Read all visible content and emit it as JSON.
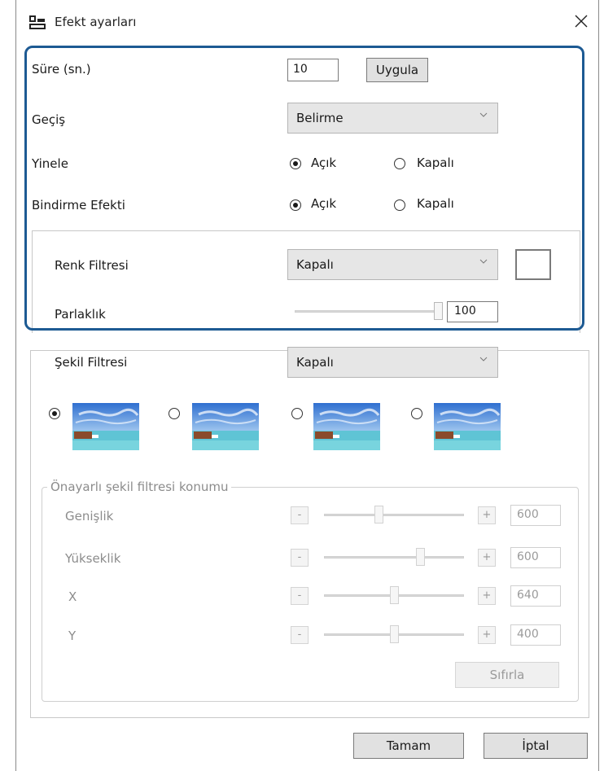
{
  "window": {
    "title": "Efekt ayarları"
  },
  "duration": {
    "label": "Süre (sn.)",
    "value": "10",
    "apply_label": "Uygula"
  },
  "transition": {
    "label": "Geçiş",
    "selected": "Belirme"
  },
  "repeat": {
    "label": "Yinele",
    "on_label": "Açık",
    "off_label": "Kapalı",
    "selected": "on"
  },
  "overlay": {
    "label": "Bindirme Efekti",
    "on_label": "Açık",
    "off_label": "Kapalı",
    "selected": "on"
  },
  "color_filter": {
    "label": "Renk Filtresi",
    "selected": "Kapalı"
  },
  "brightness": {
    "label": "Parlaklık",
    "value": "100"
  },
  "shape_filter": {
    "label": "Şekil Filtresi",
    "selected": "Kapalı",
    "selected_index": 0
  },
  "preset_position": {
    "group_label": "Önayarlı şekil filtresi konumu",
    "rows": [
      {
        "label": "Genişlik",
        "value": "600"
      },
      {
        "label": "Yükseklik",
        "value": "600"
      },
      {
        "label": "X",
        "value": "640"
      },
      {
        "label": "Y",
        "value": "400"
      }
    ],
    "minus_label": "-",
    "plus_label": "+",
    "reset_label": "Sıfırla"
  },
  "footer": {
    "ok_label": "Tamam",
    "cancel_label": "İptal"
  },
  "colors": {
    "highlight": "#1d5a93",
    "sky": "#3b7fd6",
    "sea": "#66c9d8"
  },
  "icons": {
    "title": "slideshow-icon",
    "close": "close-icon",
    "chevron": "chevron-down-icon"
  }
}
